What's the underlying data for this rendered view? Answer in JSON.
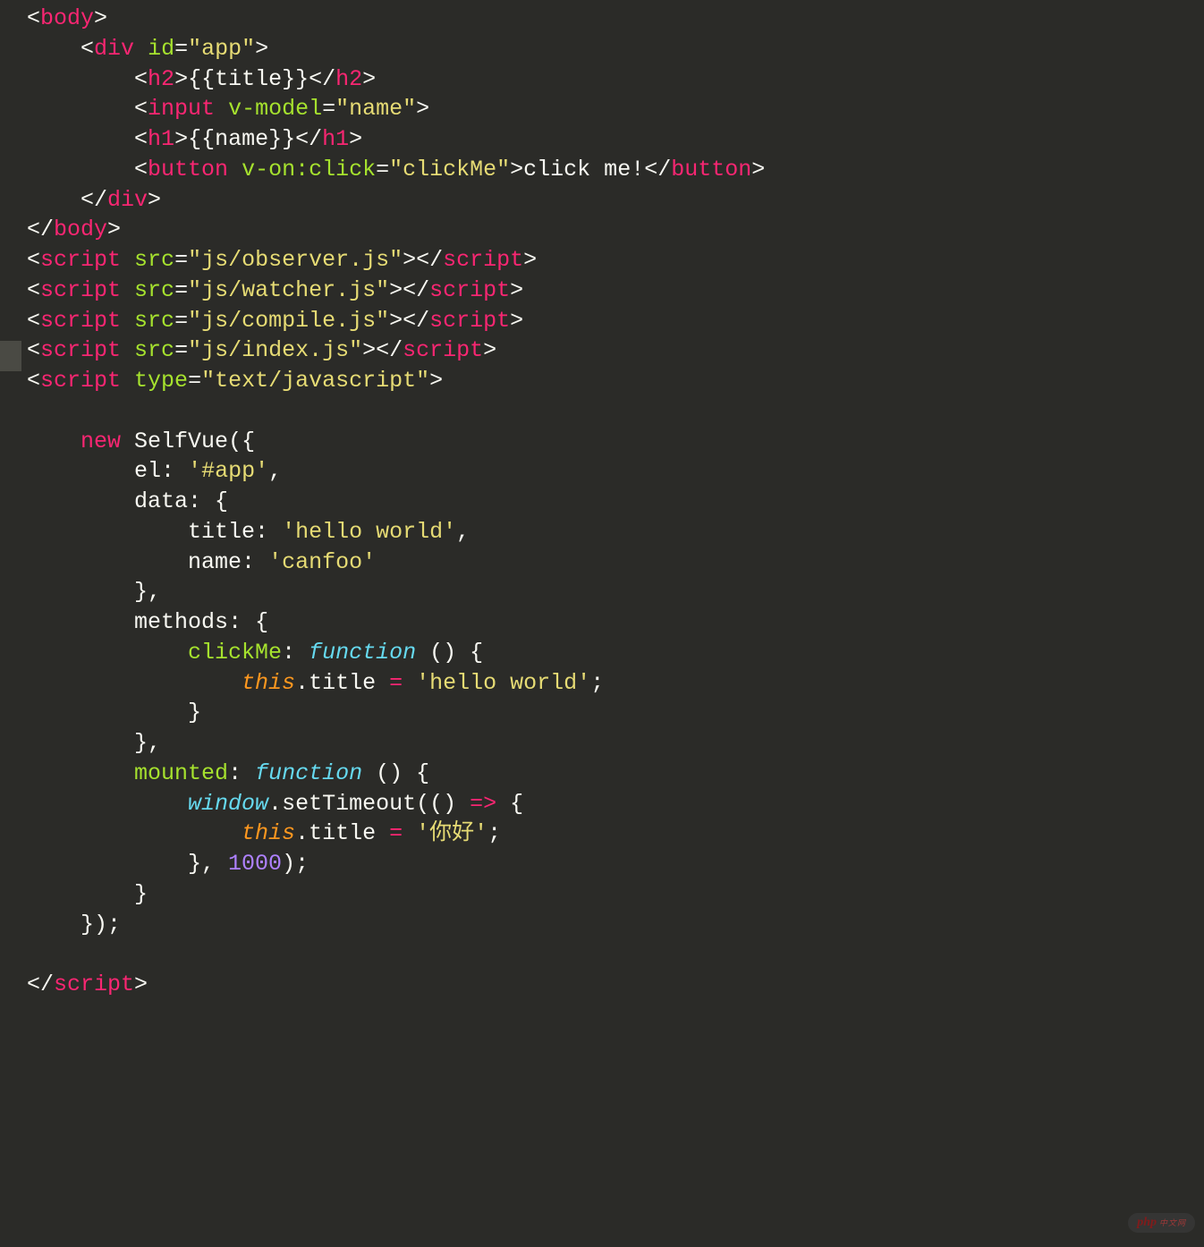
{
  "code": {
    "body_open": "body",
    "div": "div",
    "id_attr": "id",
    "app_id": "\"app\"",
    "h2": "h2",
    "title_bind": "{{title}}",
    "input": "input",
    "vmodel": "v-model",
    "name_val": "\"name\"",
    "h1": "h1",
    "name_bind": "{{name}}",
    "button": "button",
    "vonclick": "v-on:click",
    "clickme_val": "\"clickMe\"",
    "click_text": "click me!",
    "script": "script",
    "src": "src",
    "sources": {
      "observer": "\"js/observer.js\"",
      "watcher": "\"js/watcher.js\"",
      "compile": "\"js/compile.js\"",
      "index": "\"js/index.js\""
    },
    "type_attr": "type",
    "type_val": "\"text/javascript\"",
    "new_kw": "new",
    "selfvue": "SelfVue",
    "el": "el",
    "el_v": "'#app'",
    "data": "data",
    "title": "title",
    "hello": "'hello world'",
    "name": "name",
    "canfoo": "'canfoo'",
    "methods": "methods",
    "clickMe": "clickMe",
    "function": "function",
    "this": "this",
    "mounted": "mounted",
    "window": "window",
    "settimeout": "setTimeout",
    "nihao": "'你好'",
    "thousand": "1000",
    "arrow": "=>"
  },
  "watermark": {
    "main": "php",
    "sub": "中文网"
  }
}
